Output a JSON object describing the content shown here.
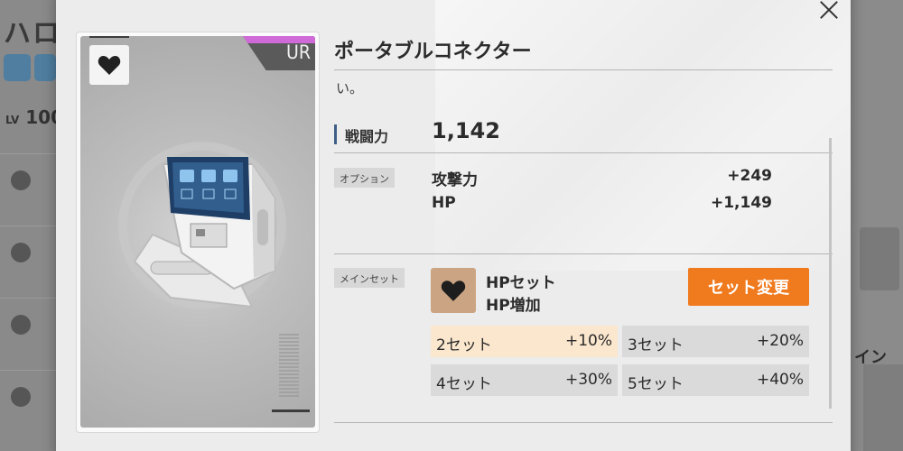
{
  "background": {
    "title": "ハロ",
    "level_prefix": "LV",
    "level_value": "100",
    "right_text": "イン"
  },
  "card": {
    "rarity": "UR",
    "type_icon": "heart-icon",
    "colors": {
      "rarity_accent": "#d06ad8"
    }
  },
  "item": {
    "name": "ポータブルコネクター",
    "description": "い。",
    "power_label": "戦闘力",
    "power_value": "1,142"
  },
  "options": {
    "tag": "オプション",
    "rows": [
      {
        "name": "攻撃力",
        "value": "+249"
      },
      {
        "name": "HP",
        "value": "+1,149"
      }
    ]
  },
  "main_set": {
    "tag": "メインセット",
    "icon": "heart-icon",
    "name": "HPセット",
    "effect": "HP増加",
    "change_button": "セット変更",
    "bonuses": [
      {
        "label": "2セット",
        "value": "+10%",
        "active": true
      },
      {
        "label": "3セット",
        "value": "+20%",
        "active": false
      },
      {
        "label": "4セット",
        "value": "+30%",
        "active": false
      },
      {
        "label": "5セット",
        "value": "+40%",
        "active": false
      }
    ],
    "colors": {
      "button": "#f07a1e",
      "active_bonus": "#fbe7ce"
    }
  }
}
